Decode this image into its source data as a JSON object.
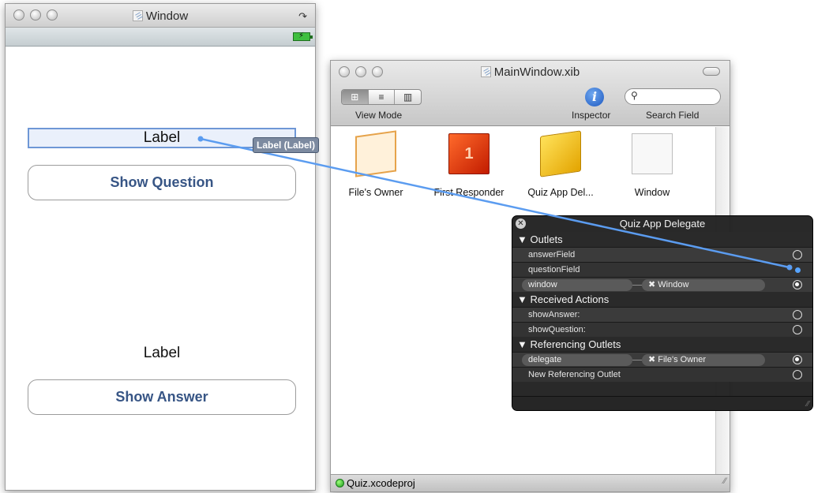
{
  "simulator": {
    "title": "Window",
    "label_top": "Label",
    "button_question": "Show Question",
    "label_bottom": "Label",
    "button_answer": "Show Answer"
  },
  "xib": {
    "title": "MainWindow.xib",
    "toolbar": {
      "view_mode_label": "View Mode",
      "inspector_label": "Inspector",
      "search_label": "Search Field"
    },
    "objects": [
      {
        "name": "File's Owner",
        "icon": "cube-outline-icon"
      },
      {
        "name": "First Responder",
        "icon": "first-responder-icon"
      },
      {
        "name": "Quiz App Del...",
        "icon": "cube-icon"
      },
      {
        "name": "Window",
        "icon": "window-icon"
      }
    ],
    "status": "Quiz.xcodeproj"
  },
  "hud": {
    "title": "Quiz App Delegate",
    "sections": {
      "outlets": "▼ Outlets",
      "actions": "▼ Received Actions",
      "referencing": "▼ Referencing Outlets"
    },
    "outlets": [
      "answerField",
      "questionField",
      "window"
    ],
    "window_target": "✖ Window",
    "actions": [
      "showAnswer:",
      "showQuestion:"
    ],
    "referencing": [
      "delegate",
      "New Referencing Outlet"
    ],
    "delegate_target": "✖ File's Owner"
  },
  "tooltip": "Label (Label)",
  "colors": {
    "connection_line": "#5b9cf0",
    "label_highlight": "#6e97d6",
    "button_text": "#375585"
  }
}
